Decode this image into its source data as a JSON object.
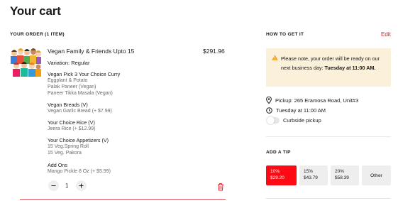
{
  "page": {
    "title": "Your cart"
  },
  "order": {
    "heading": "YOUR ORDER (1 ITEM)",
    "item": {
      "name": "Vegan Family & Friends Upto 15",
      "price": "$291.96",
      "variation": "Variation: Regular",
      "groups": [
        {
          "title": "Vegan Pick 3 Your Choice Curry",
          "values": [
            "Eggplant & Potato",
            "Palak Paneer (Vegan)",
            "Paneer Tikka Masala (Vegan)"
          ]
        },
        {
          "title": "Vegan Breads (V)",
          "values": [
            "Vegan Garlic Bread (+ $7.99)"
          ]
        },
        {
          "title": "Your Choice Rice (V)",
          "values": [
            "Jeera Rice (+ $12.99)"
          ]
        },
        {
          "title": "Your Choice Appetizers (V)",
          "values": [
            "15 Veg.Spring Roll",
            "15 Veg. Pakora"
          ]
        },
        {
          "title": "Add Ons",
          "values": [
            "Mango Pickle 8 Oz (+ $5.99)"
          ]
        }
      ],
      "quantity": "1",
      "minus_icon": "minus-icon",
      "plus_icon": "plus-icon",
      "delete_icon": "trash-icon"
    }
  },
  "how_to_get_it": {
    "heading": "HOW TO GET IT",
    "edit_label": "Edit",
    "notice": {
      "text": "Please note, your order will be ready on our next business day: ",
      "emphasis": "Tuesday at 11:00 AM.",
      "icon": "warning-icon"
    },
    "pickup": "Pickup: 265 Eramosa Road, Unit#3",
    "time": "Tuesday at 11:00 AM",
    "curbside_label": "Curbside pickup",
    "curbside_on": false
  },
  "tip": {
    "heading": "ADD A TIP",
    "options": [
      {
        "percent": "10%",
        "amount": "$29.20",
        "selected": true
      },
      {
        "percent": "15%",
        "amount": "$43.79",
        "selected": false
      },
      {
        "percent": "20%",
        "amount": "$58.39",
        "selected": false
      }
    ],
    "other_label": "Other"
  },
  "colors": {
    "accent": "#ff0a14",
    "link": "#d91f26",
    "notice_bg": "#fbf0d9",
    "notice_icon": "#f0a32b"
  }
}
